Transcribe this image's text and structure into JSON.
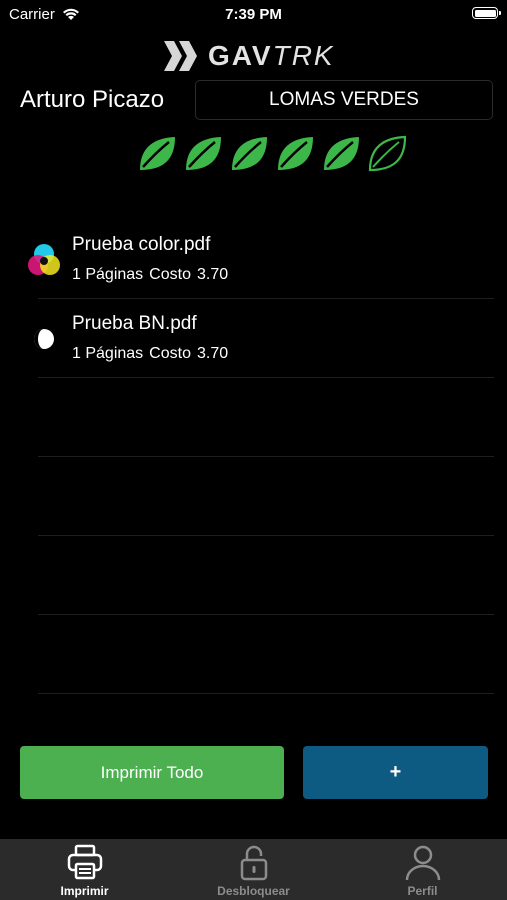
{
  "status_bar": {
    "carrier": "Carrier",
    "time": "7:39 PM"
  },
  "logo": {
    "brand_bold": "GAV",
    "brand_italic": "TRK"
  },
  "header": {
    "user_name": "Arturo Picazo",
    "location": "LOMAS VERDES"
  },
  "eco_rating": {
    "filled": 5,
    "total": 6,
    "color": "#3db64a"
  },
  "jobs": [
    {
      "name": "Prueba color.pdf",
      "pages": "1 Páginas",
      "cost_label": "Costo",
      "cost": "3.70",
      "icon": "color-print-icon"
    },
    {
      "name": "Prueba BN.pdf",
      "pages": "1 Páginas",
      "cost_label": "Costo",
      "cost": "3.70",
      "icon": "bw-print-icon"
    }
  ],
  "buttons": {
    "print_all": "Imprimir Todo",
    "add": "+"
  },
  "tabs": [
    {
      "label": "Imprimir",
      "icon": "printer-icon",
      "active": true
    },
    {
      "label": "Desbloquear",
      "icon": "unlock-icon",
      "active": false
    },
    {
      "label": "Perfil",
      "icon": "profile-icon",
      "active": false
    }
  ],
  "colors": {
    "primary_green": "#4caf50",
    "primary_blue": "#0d5a82",
    "tab_bar": "#2b2b2b"
  }
}
